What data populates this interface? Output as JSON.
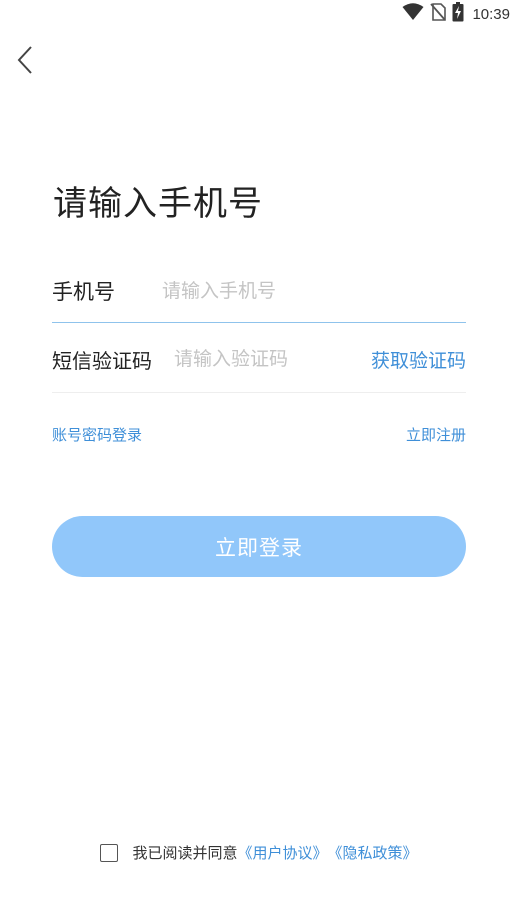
{
  "status_bar": {
    "time": "10:39",
    "icons": [
      "wifi-icon",
      "no-sim-icon",
      "battery-charging-icon"
    ]
  },
  "header": {
    "back_icon": "chevron-left-icon"
  },
  "page": {
    "title": "请输入手机号"
  },
  "form": {
    "phone_label": "手机号",
    "phone_placeholder": "请输入手机号",
    "phone_value": "",
    "code_label": "短信验证码",
    "code_placeholder": "请输入验证码",
    "code_value": "",
    "get_code_label": "获取验证码"
  },
  "links": {
    "password_login": "账号密码登录",
    "register": "立即注册"
  },
  "login_button": {
    "label": "立即登录"
  },
  "agreement": {
    "checked": false,
    "text": "我已阅读并同意",
    "user_agreement": "《用户协议》",
    "privacy_policy": "《隐私政策》"
  },
  "colors": {
    "accent": "#3f8fd8",
    "button_bg": "#91c7fa",
    "focus_line": "#8fc3ec"
  }
}
